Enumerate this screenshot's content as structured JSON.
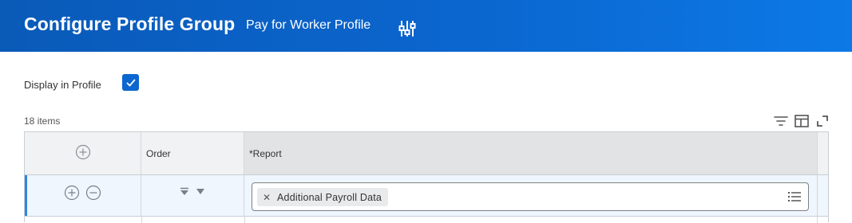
{
  "header": {
    "title": "Configure Profile Group",
    "subtitle": "Pay for Worker Profile",
    "config_icon": "sliders-icon",
    "gradient_colors": [
      "#0a5ab8",
      "#0c79e6"
    ]
  },
  "display_in_profile": {
    "label": "Display in Profile",
    "checked": true
  },
  "grid": {
    "item_count": "18 items",
    "toolbar_icons": [
      "filter-icon",
      "columns-icon",
      "expand-icon"
    ],
    "columns": [
      {
        "label": ""
      },
      {
        "label": "Order"
      },
      {
        "label": "*Report"
      }
    ],
    "rows": [
      {
        "report_value": "Additional Payroll Data",
        "report_icons": [
          "remove-x-icon",
          "list-prompt-icon"
        ]
      }
    ]
  },
  "colors": {
    "accent": "#0b66cf",
    "row_highlight": "#eff6fd",
    "selection_bar": "#2f86e0"
  }
}
